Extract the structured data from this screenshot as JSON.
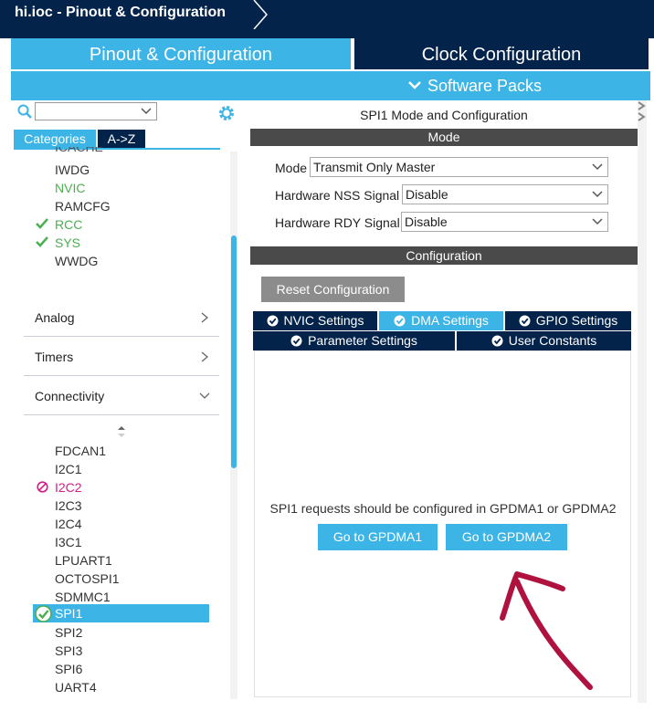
{
  "window": {
    "title": "hi.ioc - Pinout & Configuration"
  },
  "tabs": {
    "pinout": "Pinout & Configuration",
    "clock": "Clock Configuration",
    "software_packs": "Software Packs"
  },
  "left": {
    "categories_tab": "Categories",
    "az_tab": "A->Z",
    "system_items": [
      "IWDG",
      "NVIC",
      "RAMCFG",
      "RCC",
      "SYS",
      "WWDG"
    ],
    "sections": [
      "Analog",
      "Timers",
      "Connectivity"
    ],
    "connectivity_items": [
      "FDCAN1",
      "I2C1",
      "I2C2",
      "I2C3",
      "I2C4",
      "I3C1",
      "LPUART1",
      "OCTOSPI1",
      "SDMMC1",
      "SPI1",
      "SPI2",
      "SPI3",
      "SPI6",
      "UART4"
    ]
  },
  "right": {
    "title": "SPI1 Mode and Configuration",
    "mode_header": "Mode",
    "mode": {
      "label": "Mode",
      "value": "Transmit Only Master"
    },
    "nss": {
      "label": "Hardware NSS Signal",
      "value": "Disable"
    },
    "rdy": {
      "label": "Hardware RDY Signal",
      "value": "Disable"
    },
    "config_header": "Configuration",
    "reset_button": "Reset Configuration",
    "config_tabs": [
      "NVIC Settings",
      "DMA Settings",
      "GPIO Settings",
      "Parameter Settings",
      "User Constants"
    ],
    "active_tab": "DMA Settings",
    "dma_message": "SPI1 requests should be configured in GPDMA1 or GPDMA2",
    "go_gpdma1": "Go to GPDMA1",
    "go_gpdma2": "Go to GPDMA2"
  },
  "colors": {
    "navy": "#03234b",
    "accent": "#3cb4e6",
    "enabled_green": "#4caf50",
    "conflict_pink": "#d81b8c",
    "annotation_red": "#b0123f"
  }
}
